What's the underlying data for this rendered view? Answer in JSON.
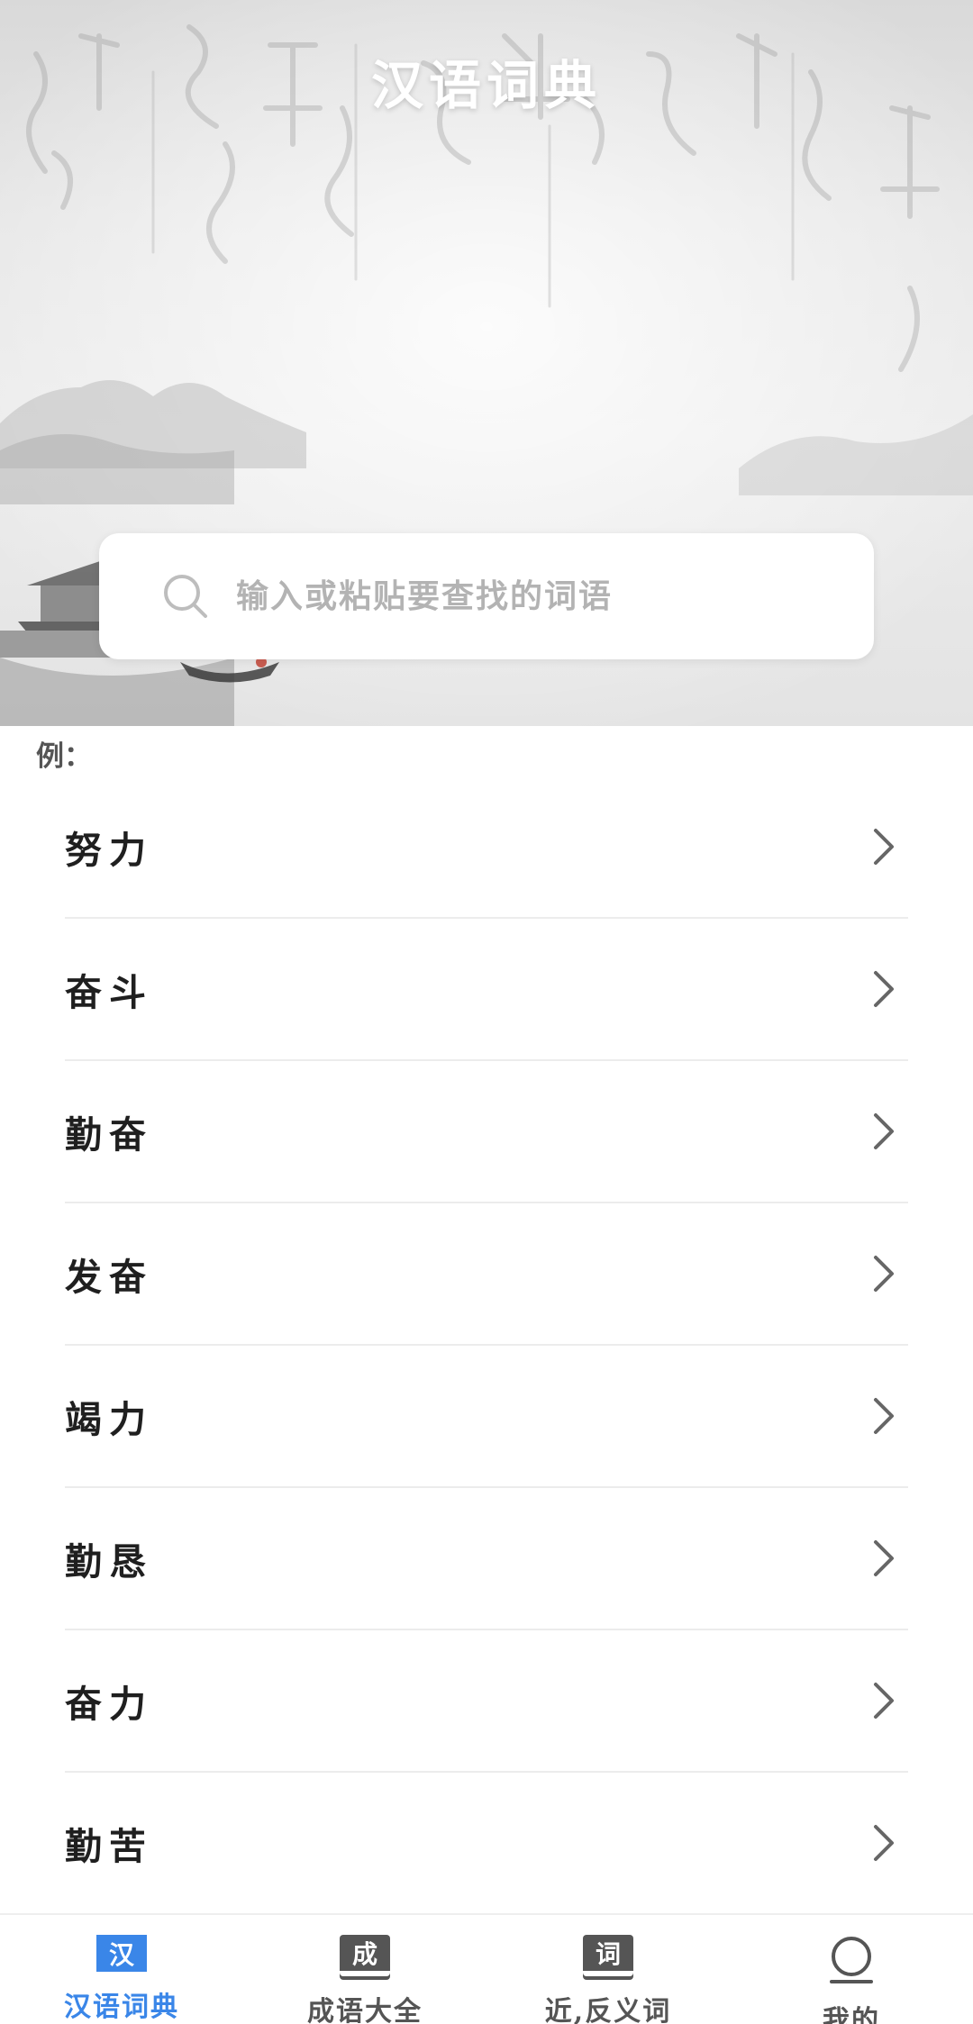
{
  "hero": {
    "title": "汉语词典"
  },
  "search": {
    "placeholder": "输入或粘贴要查找的词语"
  },
  "examples": {
    "label": "例：",
    "items": [
      {
        "word": "努力"
      },
      {
        "word": "奋斗"
      },
      {
        "word": "勤奋"
      },
      {
        "word": "发奋"
      },
      {
        "word": "竭力"
      },
      {
        "word": "勤恳"
      },
      {
        "word": "奋力"
      },
      {
        "word": "勤苦"
      }
    ]
  },
  "bottom_nav": {
    "items": [
      {
        "label": "汉语词典",
        "icon_char": "汉",
        "icon": "dictionary-icon",
        "active": true
      },
      {
        "label": "成语大全",
        "icon_char": "成",
        "icon": "idiom-book-icon",
        "active": false
      },
      {
        "label": "近,反义词",
        "icon_char": "词",
        "icon": "synonym-book-icon",
        "active": false
      },
      {
        "label": "我的",
        "icon_char": "",
        "icon": "profile-icon",
        "active": false
      }
    ]
  },
  "colors": {
    "accent": "#3a86e8",
    "inactive": "#555555",
    "text": "#1f1f1f",
    "placeholder": "#b3b3b3"
  }
}
